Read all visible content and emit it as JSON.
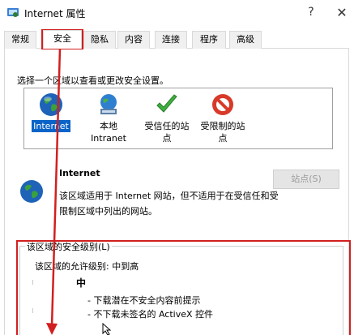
{
  "window": {
    "title": "Internet 属性",
    "help_glyph": "?",
    "close_glyph": "✕"
  },
  "tabs": [
    {
      "label": "常规",
      "active": false
    },
    {
      "label": "安全",
      "active": true
    },
    {
      "label": "隐私",
      "active": false
    },
    {
      "label": "内容",
      "active": false
    },
    {
      "label": "连接",
      "active": false
    },
    {
      "label": "程序",
      "active": false
    },
    {
      "label": "高级",
      "active": false
    }
  ],
  "security": {
    "instruction": "选择一个区域以查看或更改安全设置。",
    "zones": [
      {
        "label": "Internet",
        "icon": "globe-icon",
        "selected": true
      },
      {
        "label_line1": "本地",
        "label_line2": "Intranet",
        "icon": "intranet-icon",
        "selected": false
      },
      {
        "label_line1": "受信任的站",
        "label_line2": "点",
        "icon": "checkmark-icon",
        "selected": false
      },
      {
        "label_line1": "受限制的站",
        "label_line2": "点",
        "icon": "restricted-icon",
        "selected": false
      }
    ],
    "selected_zone_title": "Internet",
    "selected_zone_desc": "该区域适用于 Internet 网站，但不适用于在受信任和受限制区域中列出的网站。",
    "sites_button": "站点(S)",
    "level_group_label": "该区域的安全级别(L)",
    "allowed_levels": "该区域的允许级别: 中到高",
    "level_name": "中",
    "level_bullets": [
      "- 下载潜在不安全内容前提示",
      "- 不下载未签名的 ActiveX 控件"
    ]
  },
  "colors": {
    "highlight": "#0a64c8",
    "annotation_red": "#d21f1f",
    "disabled_text": "#9a9a9a"
  }
}
